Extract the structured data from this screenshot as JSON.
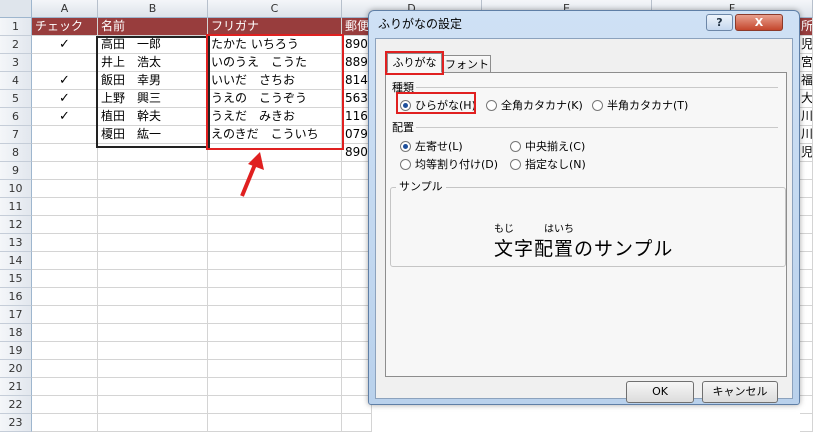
{
  "columns": [
    "A",
    "B",
    "C",
    "D",
    "E",
    "F"
  ],
  "rows": [
    "1",
    "2",
    "3",
    "4",
    "5",
    "6",
    "7",
    "8",
    "9",
    "10",
    "11",
    "12",
    "13",
    "14",
    "15",
    "16",
    "17",
    "18",
    "19",
    "20",
    "21",
    "22",
    "23"
  ],
  "header_row": {
    "a": "チェック",
    "b": "名前",
    "c": "フリガナ",
    "d": "郵便",
    "g": "所"
  },
  "data_rows": [
    {
      "check": "✓",
      "name": "高田　一郎",
      "furigana": "たかた いちろう",
      "zip": "890",
      "g": "児"
    },
    {
      "check": "",
      "name": "井上　浩太",
      "furigana": "いのうえ　こうた",
      "zip": "889",
      "g": "宮"
    },
    {
      "check": "✓",
      "name": "飯田　幸男",
      "furigana": "いいだ　さちお",
      "zip": "814",
      "g": "福"
    },
    {
      "check": "✓",
      "name": "上野　興三",
      "furigana": "うえの　こうぞう",
      "zip": "563",
      "g": "大"
    },
    {
      "check": "✓",
      "name": "植田　幹夫",
      "furigana": "うえだ　みきお",
      "zip": "116",
      "g": "川"
    },
    {
      "check": "",
      "name": "榎田　紘一",
      "furigana": "えのきだ　こういち",
      "zip": "079",
      "g": "川"
    },
    {
      "check": "",
      "name": "",
      "furigana": "",
      "zip": "890",
      "g": "児"
    }
  ],
  "dialog": {
    "title": "ふりがなの設定",
    "help_button": "?",
    "close_button": "X",
    "tabs": [
      "ふりがな",
      "フォント"
    ],
    "type_group": "種類",
    "type_options": [
      "ひらがな(H)",
      "全角カタカナ(K)",
      "半角カタカナ(T)"
    ],
    "type_selected": 0,
    "align_group": "配置",
    "align_options": [
      "左寄せ(L)",
      "中央揃え(C)",
      "均等割り付け(D)",
      "指定なし(N)"
    ],
    "align_selected": 0,
    "sample_group": "サンプル",
    "sample_ruby_1": "もじ",
    "sample_ruby_2": "はいち",
    "sample_text": "文字配置のサンプル",
    "ok_button": "OK",
    "cancel_button": "キャンセル"
  },
  "colors": {
    "header_fill": "#983d3d",
    "highlight": "#e02020",
    "dialog_frame": "#b9d1ec"
  }
}
